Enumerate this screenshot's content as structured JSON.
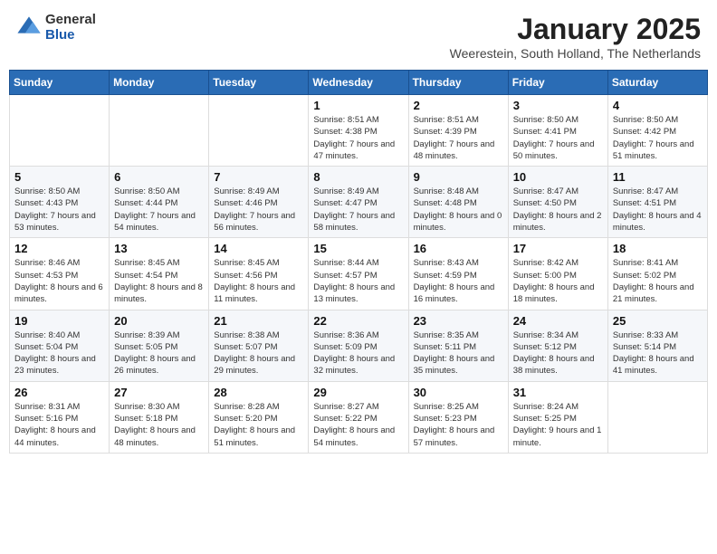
{
  "logo": {
    "general": "General",
    "blue": "Blue"
  },
  "title": {
    "month": "January 2025",
    "location": "Weerestein, South Holland, The Netherlands"
  },
  "weekdays": [
    "Sunday",
    "Monday",
    "Tuesday",
    "Wednesday",
    "Thursday",
    "Friday",
    "Saturday"
  ],
  "weeks": [
    [
      {
        "day": "",
        "info": ""
      },
      {
        "day": "",
        "info": ""
      },
      {
        "day": "",
        "info": ""
      },
      {
        "day": "1",
        "info": "Sunrise: 8:51 AM\nSunset: 4:38 PM\nDaylight: 7 hours\nand 47 minutes."
      },
      {
        "day": "2",
        "info": "Sunrise: 8:51 AM\nSunset: 4:39 PM\nDaylight: 7 hours\nand 48 minutes."
      },
      {
        "day": "3",
        "info": "Sunrise: 8:50 AM\nSunset: 4:41 PM\nDaylight: 7 hours\nand 50 minutes."
      },
      {
        "day": "4",
        "info": "Sunrise: 8:50 AM\nSunset: 4:42 PM\nDaylight: 7 hours\nand 51 minutes."
      }
    ],
    [
      {
        "day": "5",
        "info": "Sunrise: 8:50 AM\nSunset: 4:43 PM\nDaylight: 7 hours\nand 53 minutes."
      },
      {
        "day": "6",
        "info": "Sunrise: 8:50 AM\nSunset: 4:44 PM\nDaylight: 7 hours\nand 54 minutes."
      },
      {
        "day": "7",
        "info": "Sunrise: 8:49 AM\nSunset: 4:46 PM\nDaylight: 7 hours\nand 56 minutes."
      },
      {
        "day": "8",
        "info": "Sunrise: 8:49 AM\nSunset: 4:47 PM\nDaylight: 7 hours\nand 58 minutes."
      },
      {
        "day": "9",
        "info": "Sunrise: 8:48 AM\nSunset: 4:48 PM\nDaylight: 8 hours\nand 0 minutes."
      },
      {
        "day": "10",
        "info": "Sunrise: 8:47 AM\nSunset: 4:50 PM\nDaylight: 8 hours\nand 2 minutes."
      },
      {
        "day": "11",
        "info": "Sunrise: 8:47 AM\nSunset: 4:51 PM\nDaylight: 8 hours\nand 4 minutes."
      }
    ],
    [
      {
        "day": "12",
        "info": "Sunrise: 8:46 AM\nSunset: 4:53 PM\nDaylight: 8 hours\nand 6 minutes."
      },
      {
        "day": "13",
        "info": "Sunrise: 8:45 AM\nSunset: 4:54 PM\nDaylight: 8 hours\nand 8 minutes."
      },
      {
        "day": "14",
        "info": "Sunrise: 8:45 AM\nSunset: 4:56 PM\nDaylight: 8 hours\nand 11 minutes."
      },
      {
        "day": "15",
        "info": "Sunrise: 8:44 AM\nSunset: 4:57 PM\nDaylight: 8 hours\nand 13 minutes."
      },
      {
        "day": "16",
        "info": "Sunrise: 8:43 AM\nSunset: 4:59 PM\nDaylight: 8 hours\nand 16 minutes."
      },
      {
        "day": "17",
        "info": "Sunrise: 8:42 AM\nSunset: 5:00 PM\nDaylight: 8 hours\nand 18 minutes."
      },
      {
        "day": "18",
        "info": "Sunrise: 8:41 AM\nSunset: 5:02 PM\nDaylight: 8 hours\nand 21 minutes."
      }
    ],
    [
      {
        "day": "19",
        "info": "Sunrise: 8:40 AM\nSunset: 5:04 PM\nDaylight: 8 hours\nand 23 minutes."
      },
      {
        "day": "20",
        "info": "Sunrise: 8:39 AM\nSunset: 5:05 PM\nDaylight: 8 hours\nand 26 minutes."
      },
      {
        "day": "21",
        "info": "Sunrise: 8:38 AM\nSunset: 5:07 PM\nDaylight: 8 hours\nand 29 minutes."
      },
      {
        "day": "22",
        "info": "Sunrise: 8:36 AM\nSunset: 5:09 PM\nDaylight: 8 hours\nand 32 minutes."
      },
      {
        "day": "23",
        "info": "Sunrise: 8:35 AM\nSunset: 5:11 PM\nDaylight: 8 hours\nand 35 minutes."
      },
      {
        "day": "24",
        "info": "Sunrise: 8:34 AM\nSunset: 5:12 PM\nDaylight: 8 hours\nand 38 minutes."
      },
      {
        "day": "25",
        "info": "Sunrise: 8:33 AM\nSunset: 5:14 PM\nDaylight: 8 hours\nand 41 minutes."
      }
    ],
    [
      {
        "day": "26",
        "info": "Sunrise: 8:31 AM\nSunset: 5:16 PM\nDaylight: 8 hours\nand 44 minutes."
      },
      {
        "day": "27",
        "info": "Sunrise: 8:30 AM\nSunset: 5:18 PM\nDaylight: 8 hours\nand 48 minutes."
      },
      {
        "day": "28",
        "info": "Sunrise: 8:28 AM\nSunset: 5:20 PM\nDaylight: 8 hours\nand 51 minutes."
      },
      {
        "day": "29",
        "info": "Sunrise: 8:27 AM\nSunset: 5:22 PM\nDaylight: 8 hours\nand 54 minutes."
      },
      {
        "day": "30",
        "info": "Sunrise: 8:25 AM\nSunset: 5:23 PM\nDaylight: 8 hours\nand 57 minutes."
      },
      {
        "day": "31",
        "info": "Sunrise: 8:24 AM\nSunset: 5:25 PM\nDaylight: 9 hours\nand 1 minute."
      },
      {
        "day": "",
        "info": ""
      }
    ]
  ]
}
